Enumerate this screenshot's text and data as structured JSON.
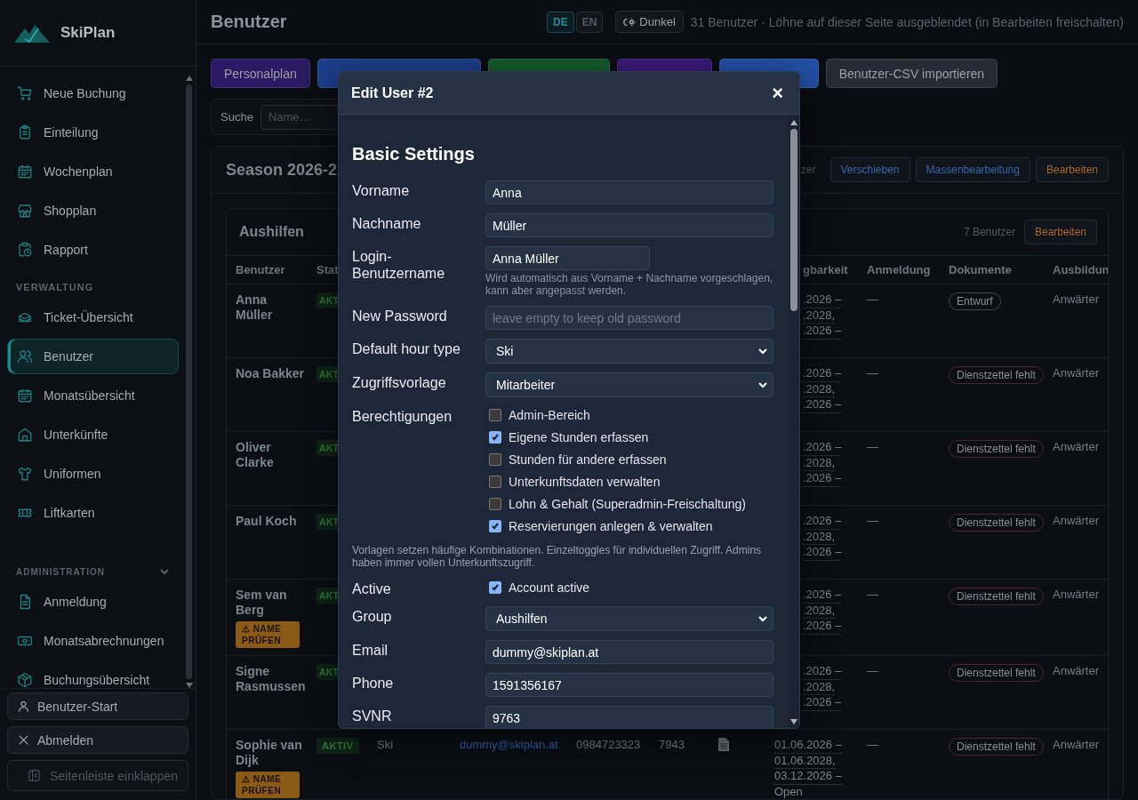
{
  "sidebar": {
    "brand": "SkiPlan",
    "groups": [
      {
        "items": [
          {
            "label": "Neue Buchung",
            "selected": false
          },
          {
            "label": "Einteilung",
            "selected": false
          },
          {
            "label": "Wochenplan",
            "selected": false
          },
          {
            "label": "Shopplan",
            "selected": false
          },
          {
            "label": "Rapport",
            "selected": false
          }
        ]
      },
      {
        "heading": "VERWALTUNG",
        "items": [
          {
            "label": "Ticket-Übersicht",
            "selected": false
          },
          {
            "label": "Benutzer",
            "selected": true
          },
          {
            "label": "Monatsübersicht",
            "selected": false
          },
          {
            "label": "Unterkünfte",
            "selected": false
          },
          {
            "label": "Uniformen",
            "selected": false
          },
          {
            "label": "Liftkarten",
            "selected": false
          }
        ]
      },
      {
        "heading": "ADMINISTRATION",
        "expanded": true,
        "items": [
          {
            "label": "Anmeldung",
            "selected": false
          },
          {
            "label": "Monatsabrechnungen",
            "selected": false
          },
          {
            "label": "Buchungsübersicht",
            "selected": false
          }
        ]
      }
    ],
    "footer": [
      {
        "label": "Benutzer-Start",
        "disabled": false
      },
      {
        "label": "Abmelden",
        "disabled": false
      },
      {
        "label": "Seitenleiste einklappen",
        "disabled": true
      }
    ]
  },
  "header": {
    "title": "Benutzer",
    "languages": [
      {
        "label": "DE",
        "selected": true
      },
      {
        "label": "EN",
        "selected": false
      }
    ],
    "theme_button": "Dunkel",
    "info": "31 Benutzer · Löhne auf dieser Seite ausgeblendet (in Bearbeiten freischalten)"
  },
  "toolbar": [
    {
      "label": "Personalplan",
      "color": "#2b1a63"
    },
    {
      "color": "#1d3f8c"
    },
    {
      "color": "#155c2e"
    },
    {
      "color": "#3a1a7a"
    },
    {
      "color": "#2351a8"
    },
    {
      "label": "Benutzer-CSV importieren",
      "color": "#262c33"
    }
  ],
  "search": {
    "label": "Suche",
    "placeholder": "Name…"
  },
  "season": {
    "title": "Season 2026-2",
    "count": "zer",
    "buttons": [
      {
        "label": "Verschieben",
        "kind": "info"
      },
      {
        "label": "Massenbearbeitung",
        "kind": "info"
      },
      {
        "label": "Bearbeiten",
        "kind": "warning"
      }
    ]
  },
  "group": {
    "title": "Aushilfen",
    "count": "7 Benutzer",
    "button": "Bearbeiten"
  },
  "table": {
    "columns": [
      "Benutzer",
      "Stat",
      "gbarkeit",
      "Anmeldung",
      "Dokumente",
      "Ausbildun"
    ],
    "rows": [
      {
        "covered": true,
        "name": "Anna Müller",
        "status": "AKT",
        "dates": [
          ".2026 –",
          ".2028,",
          ".2026 –"
        ],
        "registration": "—",
        "document": "Entwurf",
        "color": "#3d444d",
        "training": "Anwärter"
      },
      {
        "covered": true,
        "name": "Noa Bakker",
        "status": "AKT",
        "dates": [
          ".2026 –",
          ".2028,",
          ".2026 –"
        ],
        "registration": "—",
        "document": "Dienstzettel fehlt",
        "color": "#4a2626",
        "training": "Anwärter"
      },
      {
        "covered": true,
        "name": "Oliver Clarke",
        "status": "AKT",
        "dates": [
          ".2026 –",
          ".2028,",
          ".2026 –"
        ],
        "registration": "—",
        "document": "Dienstzettel fehlt",
        "color": "#4a2626",
        "training": "Anwärter"
      },
      {
        "covered": true,
        "name": "Paul Koch",
        "status": "AKT",
        "dates": [
          ".2026 –",
          ".2028,",
          ".2026 –"
        ],
        "registration": "—",
        "document": "Dienstzettel fehlt",
        "color": "#4a2626",
        "training": "Anwärter"
      },
      {
        "covered": true,
        "name": "Sem van Berg",
        "warning": "⚠ NAME PRÜFEN",
        "status": "AKT",
        "dates": [
          ".2026 –",
          ".2028,",
          ".2026 –"
        ],
        "registration": "—",
        "document": "Dienstzettel fehlt",
        "color": "#4a2626",
        "training": "Anwärter"
      },
      {
        "covered": true,
        "name": "Signe Rasmussen",
        "status": "AKT",
        "dates": [
          ".2026 –",
          ".2028,",
          ".2026 –"
        ],
        "registration": "—",
        "document": "Dienstzettel fehlt",
        "color": "#4a2626",
        "training": "Anwärter"
      },
      {
        "covered": false,
        "name": "Sophie van Dijk",
        "warning": "⚠ NAME PRÜFEN",
        "status": "AKTIV",
        "hour_type": "Ski",
        "email": "dummy@skiplan.at",
        "phone": "0984723323",
        "svnr": "7943",
        "has_file": true,
        "dates": [
          "01.06.2026 –",
          "01.06.2028,",
          "03.12.2026 –",
          "Open"
        ],
        "registration": "—",
        "document": "Dienstzettel fehlt",
        "color": "#4a2626",
        "training": "Anwärter"
      }
    ]
  },
  "dialog": {
    "title": "Edit User #2",
    "close": "×",
    "section": "Basic Settings",
    "fields": [
      {
        "kind": "text",
        "label": "Vorname",
        "value": "Anna"
      },
      {
        "kind": "text",
        "label": "Nachname",
        "value": "Müller"
      },
      {
        "kind": "text",
        "label": "Login-Benutzername",
        "value": "Anna Müller",
        "hint": "Wird automatisch aus Vorname + Nachname vorgeschlagen, kann aber angepasst werden."
      },
      {
        "kind": "text",
        "label": "New Password",
        "placeholder": "leave empty to keep old password"
      },
      {
        "kind": "select",
        "label": "Default hour type",
        "value": "Ski"
      },
      {
        "kind": "select",
        "label": "Zugriffsvorlage",
        "value": "Mitarbeiter"
      },
      {
        "kind": "checklist",
        "label": "Berechtigungen",
        "options": [
          {
            "label": "Admin-Bereich",
            "checked": false
          },
          {
            "label": "Eigene Stunden erfassen",
            "checked": true
          },
          {
            "label": "Stunden für andere erfassen",
            "checked": false
          },
          {
            "label": "Unterkunftsdaten verwalten",
            "checked": false
          },
          {
            "label": "Lohn & Gehalt (Superadmin-Freischaltung)",
            "checked": false
          },
          {
            "label": "Reservierungen anlegen & verwalten",
            "checked": true
          }
        ]
      },
      {
        "kind": "note",
        "text": "Vorlagen setzen häufige Kombinationen. Einzeltoggles für individuellen Zugriff. Admins haben immer vollen Unterkunftszugriff."
      },
      {
        "kind": "checkbox",
        "label": "Active",
        "option": "Account active",
        "checked": true
      },
      {
        "kind": "select",
        "label": "Group",
        "value": "Aushilfen"
      },
      {
        "kind": "text",
        "label": "Email",
        "value": "dummy@skiplan.at"
      },
      {
        "kind": "text",
        "label": "Phone",
        "value": "1591356167"
      },
      {
        "kind": "text",
        "label": "SVNR",
        "value": "9763"
      }
    ]
  }
}
